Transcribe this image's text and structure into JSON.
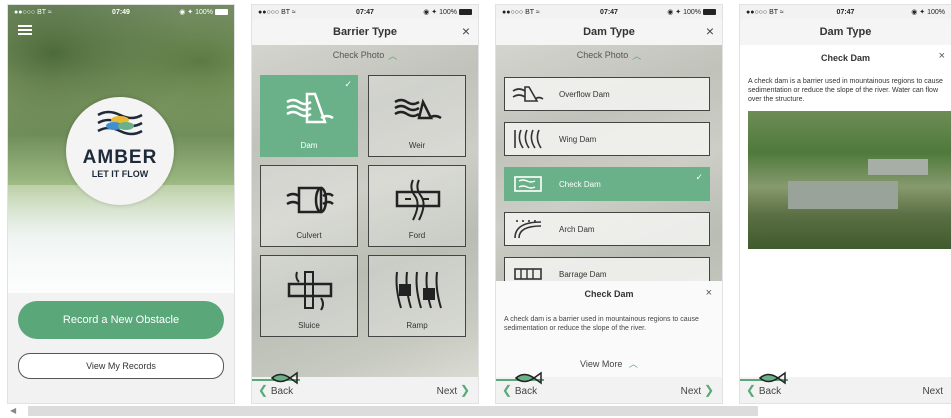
{
  "status": {
    "carrier": "BT",
    "time1": "07:49",
    "time2": "07:47",
    "time3": "07:47",
    "time4": "07:47",
    "battery": "100%"
  },
  "phone1": {
    "logo_title": "AMBER",
    "logo_subtitle": "LET IT FLOW",
    "primary_button": "Record a New Obstacle",
    "secondary_button": "View My Records"
  },
  "phone2": {
    "title": "Barrier Type",
    "subtitle": "Check Photo",
    "tiles": [
      {
        "label": "Dam",
        "selected": true
      },
      {
        "label": "Weir",
        "selected": false
      },
      {
        "label": "Culvert",
        "selected": false
      },
      {
        "label": "Ford",
        "selected": false
      },
      {
        "label": "Sluice",
        "selected": false
      },
      {
        "label": "Ramp",
        "selected": false
      }
    ],
    "back": "Back",
    "next": "Next"
  },
  "phone3": {
    "title": "Dam Type",
    "subtitle": "Check Photo",
    "rows": [
      {
        "label": "Overflow Dam"
      },
      {
        "label": "Wing Dam"
      },
      {
        "label": "Check Dam"
      },
      {
        "label": "Arch Dam"
      },
      {
        "label": "Barrage Dam"
      }
    ],
    "sheet_title": "Check Dam",
    "sheet_desc": "A check dam is a barrier used in mountainous regions to cause sedimentation or reduce the slope of the river.",
    "view_more": "View More",
    "back": "Back",
    "next": "Next"
  },
  "phone4": {
    "title": "Dam Type",
    "header": "Check Dam",
    "description": "A check dam is a barrier used in mountainous regions to cause sedimentation or reduce the slope of the river. Water can flow over the structure.",
    "back": "Back",
    "next": "Next"
  },
  "colors": {
    "accent": "#5aa77a",
    "selected_tile": "#6ab088"
  }
}
